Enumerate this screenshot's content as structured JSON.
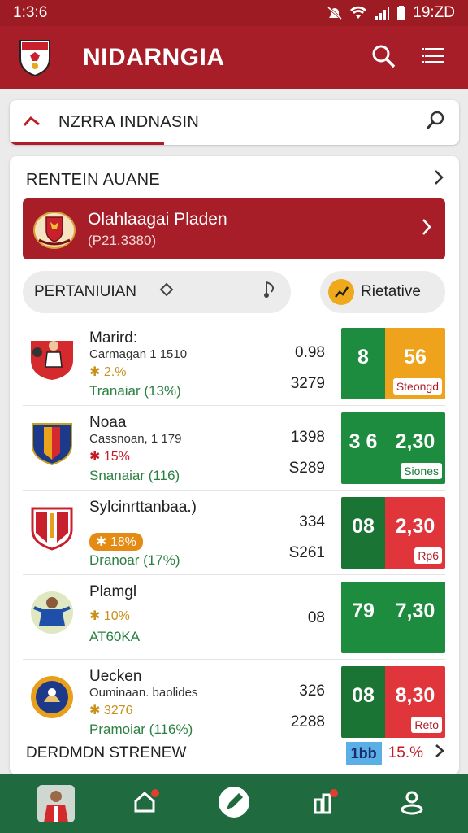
{
  "status": {
    "time_left": "1:3:6",
    "time_right": "19:ZD"
  },
  "app": {
    "title": "NIDARNGIA"
  },
  "search": {
    "text": "NZRRA INDNASIN"
  },
  "section": {
    "title": "RENTEIN AUANE"
  },
  "promo": {
    "title": "Olahlaagai Pladen",
    "subtitle": "(P21.3380)"
  },
  "filters": {
    "left_label": "PERTANIUIAN",
    "right_label": "Rietative"
  },
  "rows": [
    {
      "name": "Marird:",
      "meta": "Carmagan 1 1510",
      "pct": "2.%",
      "trend": "Tranaiar (13%)",
      "val1": "0.98",
      "val2": "3279",
      "score_left": "8",
      "score_right": "56",
      "tag": "Steongd"
    },
    {
      "name": "Noaa",
      "meta": "Cassnoan, 1 179",
      "pct": "15%",
      "trend": "Snanaiar (116)",
      "val1": "1398",
      "val2": "S289",
      "score_left": "3 6",
      "score_right": "2,30",
      "tag": "Siones"
    },
    {
      "name": "Sylcinrttanbaa.)",
      "meta": "",
      "pct": "18%",
      "trend": "Dranoar (17%)",
      "val1": "334",
      "val2": "S261",
      "score_left": "08",
      "score_right": "2,30",
      "tag": "Rp6"
    },
    {
      "name": "Plamgl",
      "meta": "",
      "pct": "10%",
      "trend": "AT60KA",
      "val1": "08",
      "val2": "",
      "score_left": "79",
      "score_right": "7,30",
      "tag": ""
    },
    {
      "name": "Uecken",
      "meta": "Ouminaan. baolides",
      "pct": "3276",
      "trend": "Pramoiar (116%)",
      "val1": "326",
      "val2": "2288",
      "score_left": "08",
      "score_right": "8,30",
      "tag": "Reto"
    }
  ],
  "footer": {
    "label": "DERDMDN STRENEW",
    "badge": "1bb",
    "pct": "15.%"
  },
  "colors": {
    "brand_red": "#a71d28",
    "nav_green": "#1f6b3f",
    "score_green": "#1e8c3e",
    "score_dark_green": "#1a7434",
    "score_orange": "#efa21c",
    "score_red": "#e0353a"
  }
}
